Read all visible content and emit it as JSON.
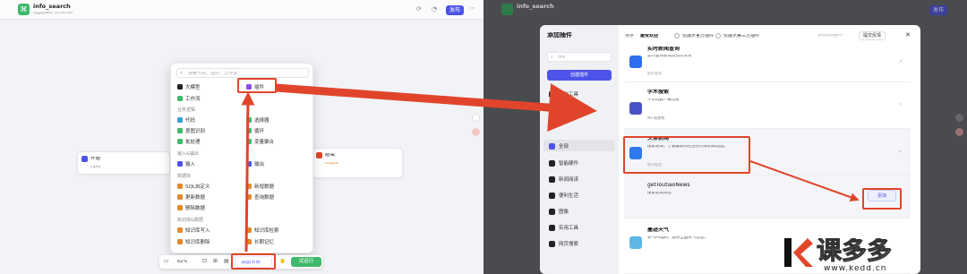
{
  "left": {
    "app_title": "info_search",
    "app_subtitle": "已自动保存 15:35:40",
    "publish_label": "发布",
    "search_placeholder": "搜索节点、插件、工作流",
    "items": {
      "llm": "大模型",
      "plugin": "插件",
      "workflow": "工作流"
    },
    "sections": {
      "business": "业务逻辑",
      "io": "输入&输出",
      "database": "数据库",
      "knowledge": "知识库&数据"
    },
    "business_items": [
      "代码",
      "选择器",
      "意图识别",
      "循环",
      "批处理",
      "变量聚合"
    ],
    "io_items": [
      "输入",
      "输出"
    ],
    "db_items": [
      "SQL自定义",
      "新增数据",
      "更新数据",
      "查询数据",
      "删除数据"
    ],
    "knowledge_items": [
      "知识库写入",
      "知识库检索",
      "知识库删除",
      "长期记忆"
    ],
    "start_node": {
      "title": "开始",
      "param": "input"
    },
    "end_node": {
      "title": "结束",
      "param": "output"
    },
    "toolbar": {
      "zoom": "62%",
      "add_node": "添加节点",
      "run": "试运行"
    }
  },
  "right": {
    "app_title": "info_search",
    "publish_label": "发布",
    "modal": {
      "title": "添加插件",
      "search_placeholder": "搜索",
      "create_button": "创建插件",
      "sidebar_items": [
        "我的工具",
        "全部",
        "智能硬件",
        "新闻阅读",
        "便利生活",
        "图像",
        "实用工具",
        "网页搜索"
      ],
      "filter_label": "排序",
      "filter_value": "最受欢迎",
      "radio_official": "仅展示官方插件",
      "radio_third": "仅展示第三方插件",
      "feedback": "提交反馈",
      "help": "没有找到插件?",
      "add_label": "添加"
    },
    "cards": [
      {
        "title": "实时新闻查询",
        "desc": "实时查询新闻及热点资讯",
        "publisher": "扣子官方"
      },
      {
        "title": "学术搜索",
        "desc": "学术问题? 来问我",
        "publisher": "Mo 植物物"
      },
      {
        "title": "头条新闻",
        "desc": "搜索新闻，了解最新的社会热点和新闻动态。",
        "publisher": "扣子官方"
      },
      {
        "title": "getToutiaoNews",
        "desc": "搜索新闻讯息"
      },
      {
        "title": "墨迹天气",
        "desc": "天气Plugin，提供全国天气信息。"
      }
    ]
  },
  "watermark": {
    "brand": "课多多",
    "url": "www.kedd.cn"
  }
}
